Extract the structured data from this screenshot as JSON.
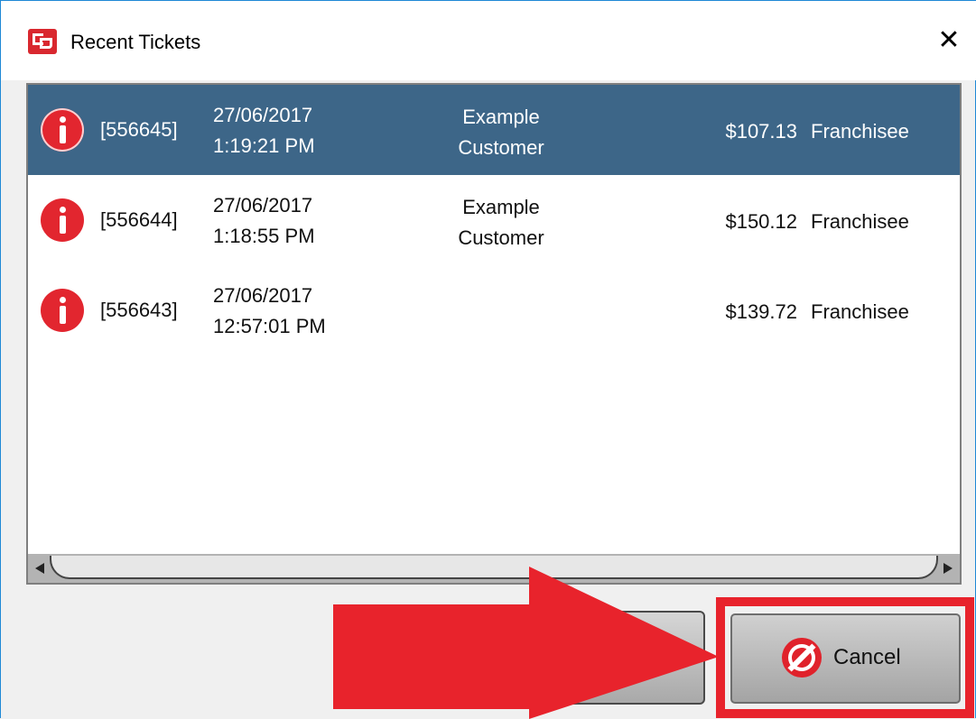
{
  "window": {
    "title": "Recent Tickets",
    "close_glyph": "✕",
    "icon": "app-logo-icon"
  },
  "tickets": [
    {
      "id": "[556645]",
      "date": "27/06/2017",
      "time": "1:19:21 PM",
      "customer_line1": "Example",
      "customer_line2": "Customer",
      "amount": "$107.13",
      "role": "Franchisee",
      "selected": true,
      "icon": "info-icon"
    },
    {
      "id": "[556644]",
      "date": "27/06/2017",
      "time": "1:18:55 PM",
      "customer_line1": "Example",
      "customer_line2": "Customer",
      "amount": "$150.12",
      "role": "Franchisee",
      "selected": false,
      "icon": "info-icon"
    },
    {
      "id": "[556643]",
      "date": "27/06/2017",
      "time": "12:57:01 PM",
      "customer_line1": "",
      "customer_line2": "",
      "amount": "$139.72",
      "role": "Franchisee",
      "selected": false,
      "icon": "info-icon"
    }
  ],
  "buttons": {
    "cancel_label": "Cancel",
    "cancel_icon": "no-entry-icon"
  },
  "colors": {
    "selection": "#3d6688",
    "accent_red": "#e8232c",
    "info_red": "#e2262f"
  }
}
